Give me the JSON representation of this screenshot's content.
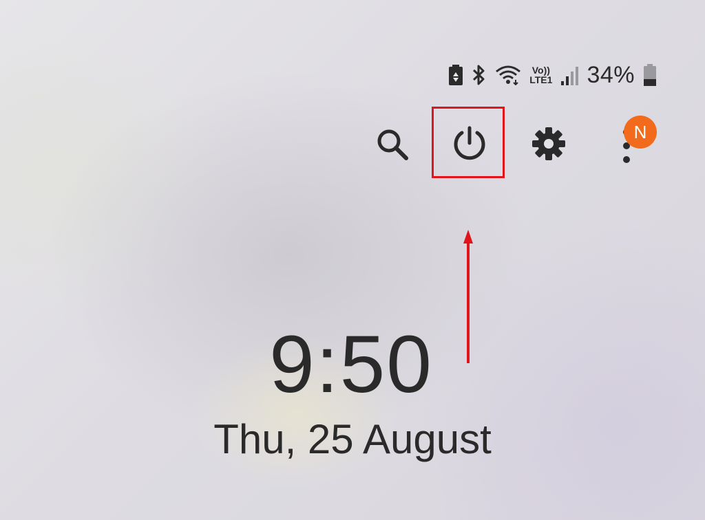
{
  "status_bar": {
    "icons": [
      "battery-saver-icon",
      "bluetooth-icon",
      "wifi-icon",
      "volte-lte-icon",
      "signal-icon",
      "battery-icon"
    ],
    "volte_label": "Vo))",
    "lte_label": "LTE1",
    "battery_percent": "34%",
    "battery_level": 0.34
  },
  "quick_actions": {
    "icons": [
      "search-icon",
      "power-icon",
      "settings-icon",
      "more-options-icon"
    ],
    "notification_badge": "N",
    "badge_color": "#f26b1d"
  },
  "annotation": {
    "highlight_color": "#e0141b",
    "target": "power-icon"
  },
  "lock_screen": {
    "time": "9:50",
    "date": "Thu, 25 August"
  }
}
